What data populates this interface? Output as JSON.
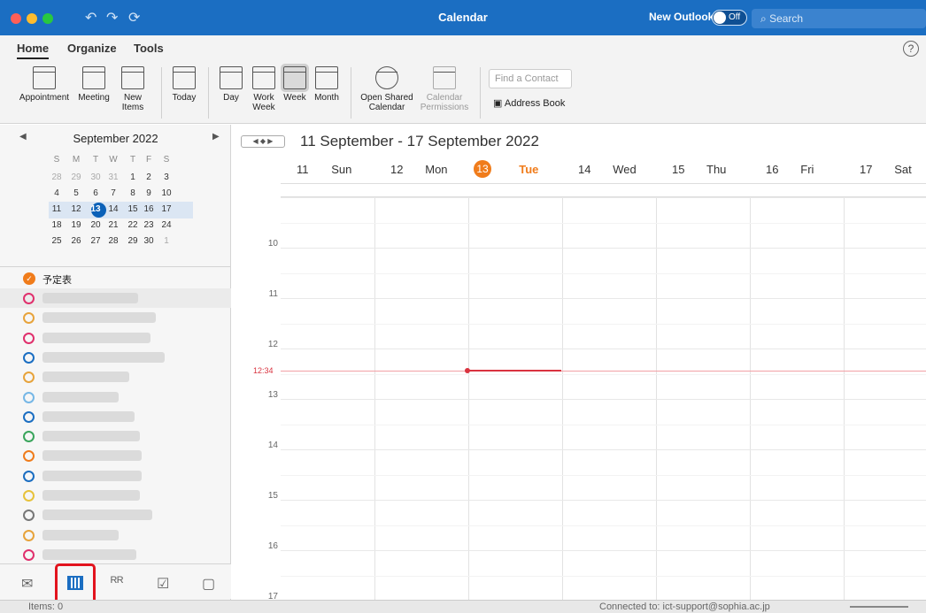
{
  "titlebar": {
    "title": "Calendar",
    "new_outlook_label": "New Outlook",
    "toggle_state": "Off",
    "search_placeholder": "Search"
  },
  "tabs": [
    "Home",
    "Organize",
    "Tools"
  ],
  "ribbon": {
    "appointment": "Appointment",
    "meeting": "Meeting",
    "new_items_1": "New",
    "new_items_2": "Items",
    "today": "Today",
    "day": "Day",
    "work_week_1": "Work",
    "work_week_2": "Week",
    "week": "Week",
    "month": "Month",
    "open_shared_1": "Open Shared",
    "open_shared_2": "Calendar",
    "perm_1": "Calendar",
    "perm_2": "Permissions",
    "find_contact_placeholder": "Find a Contact",
    "address_book": "Address Book"
  },
  "mini_calendar": {
    "month_label": "September 2022",
    "weekdays": [
      "S",
      "M",
      "T",
      "W",
      "T",
      "F",
      "S"
    ],
    "weeks": [
      [
        "28",
        "29",
        "30",
        "31",
        "1",
        "2",
        "3"
      ],
      [
        "4",
        "5",
        "6",
        "7",
        "8",
        "9",
        "10"
      ],
      [
        "11",
        "12",
        "13",
        "14",
        "15",
        "16",
        "17"
      ],
      [
        "18",
        "19",
        "20",
        "21",
        "22",
        "23",
        "24"
      ],
      [
        "25",
        "26",
        "27",
        "28",
        "29",
        "30",
        "1"
      ]
    ],
    "today": "13"
  },
  "calendars": {
    "first_label": "予定表"
  },
  "main": {
    "range_label": "11 September - 17 September 2022",
    "days": [
      {
        "num": "11",
        "name": "Sun"
      },
      {
        "num": "12",
        "name": "Mon"
      },
      {
        "num": "13",
        "name": "Tue"
      },
      {
        "num": "14",
        "name": "Wed"
      },
      {
        "num": "15",
        "name": "Thu"
      },
      {
        "num": "16",
        "name": "Fri"
      },
      {
        "num": "17",
        "name": "Sat"
      }
    ],
    "hours": [
      "10",
      "11",
      "12",
      "13",
      "14",
      "15",
      "16",
      "17"
    ],
    "now_label": "12:34"
  },
  "status": {
    "items": "Items: 0",
    "connection": "Connected to: ict-support@sophia.ac.jp"
  },
  "colors": {
    "accent": "#1b6ec2",
    "today": "#f07c1b",
    "now": "#d9333f",
    "highlight": "#e2131d"
  }
}
